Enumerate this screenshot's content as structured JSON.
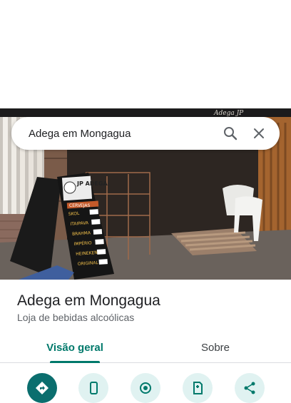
{
  "search": {
    "query": "Adega em Mongagua"
  },
  "place": {
    "name": "Adega em Mongagua",
    "category": "Loja de bebidas alcoólicas"
  },
  "tabs": [
    {
      "label": "Visão geral",
      "active": true
    },
    {
      "label": "Sobre",
      "active": false
    }
  ],
  "photo": {
    "sign_text": "JP ADEGA",
    "menu_heading": "CERVEJAS",
    "menu_items": [
      "SKOL",
      "ITAIPAVA",
      "BRAHMA",
      "IMPÉRIO",
      "HEINEKEN",
      "ORIGINAL"
    ],
    "awning_text": "Adega JP"
  },
  "actions": [
    {
      "icon": "directions-icon",
      "primary": true
    },
    {
      "icon": "phone-icon",
      "primary": false
    },
    {
      "icon": "start-icon",
      "primary": false
    },
    {
      "icon": "save-icon",
      "primary": false
    },
    {
      "icon": "share-icon",
      "primary": false
    }
  ],
  "colors": {
    "accent": "#00796b",
    "chip": "#e0f2f1",
    "primary_button": "#0b6e6e"
  }
}
